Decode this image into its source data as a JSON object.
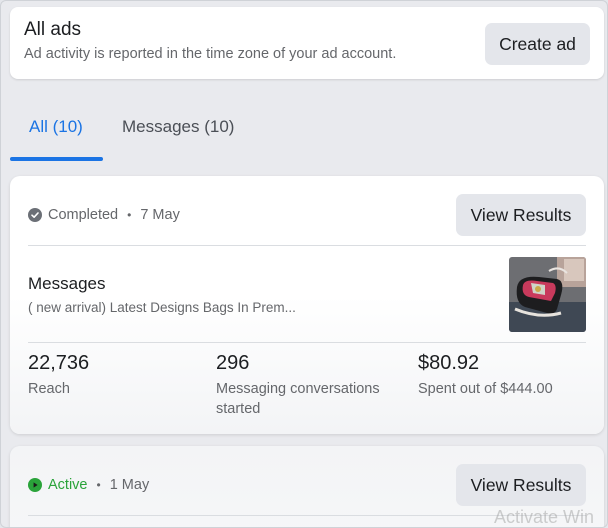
{
  "header": {
    "title": "All ads",
    "subtitle": "Ad activity is reported in the time zone of your ad account.",
    "create_label": "Create ad"
  },
  "tabs": [
    {
      "label": "All (10)",
      "active": true
    },
    {
      "label": "Messages (10)",
      "active": false
    }
  ],
  "ads": [
    {
      "status": "Completed",
      "date": "7 May",
      "view_label": "View Results",
      "title": "Messages",
      "description": "( new arrival) Latest Designs Bags In Prem...",
      "metrics": [
        {
          "value": "22,736",
          "label": "Reach"
        },
        {
          "value": "296",
          "label": "Messaging conversations started"
        },
        {
          "value": "$80.92",
          "label": "Spent out of $444.00"
        }
      ]
    },
    {
      "status": "Active",
      "date": "1 May",
      "view_label": "View Results"
    }
  ],
  "separator": "•",
  "watermark": "Activate Win",
  "colors": {
    "accent": "#1b74e4",
    "active_status": "#2aa33a",
    "completed_status": "#6b6f76",
    "button_bg": "#e4e6eb"
  },
  "icons": {
    "completed": "check-circle-icon",
    "active": "play-circle-icon"
  }
}
